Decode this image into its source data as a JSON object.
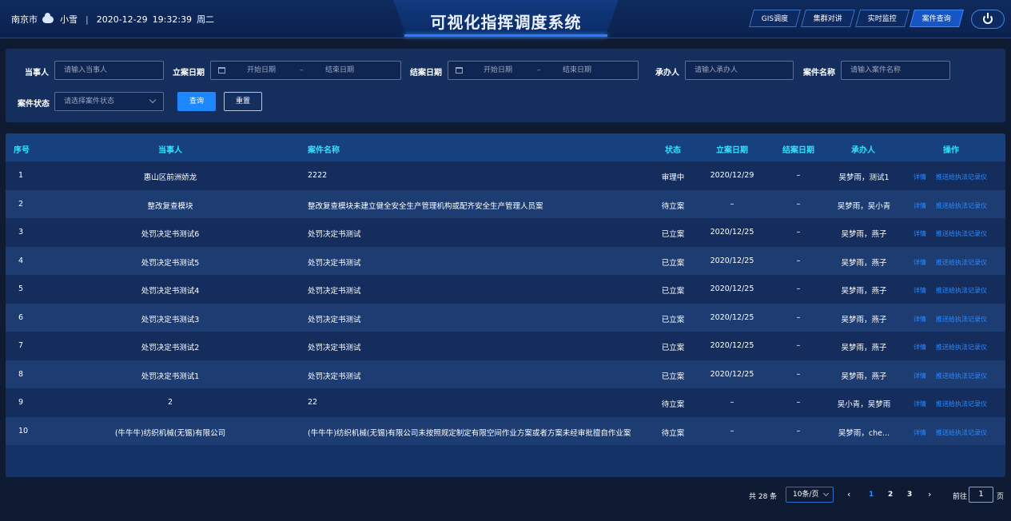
{
  "header": {
    "city": "南京市",
    "weather_icon": "cloud-icon",
    "weather": "小雪",
    "date": "2020-12-29",
    "time": "19:32:39",
    "weekday": "周二",
    "title": "可视化指挥调度系统",
    "nav": [
      "GIS调度",
      "集群对讲",
      "实时监控",
      "案件查询"
    ],
    "active_nav": "案件查询",
    "power_icon": "power-icon"
  },
  "filter": {
    "party_label": "当事人",
    "party_placeholder": "请输入当事人",
    "filing_date_label": "立案日期",
    "closing_date_label": "结案日期",
    "start_placeholder": "开始日期",
    "end_placeholder": "结束日期",
    "range_sep": "–",
    "handler_label": "承办人",
    "handler_placeholder": "请输入承办人",
    "case_name_label": "案件名称",
    "case_name_placeholder": "请输入案件名称",
    "status_label": "案件状态",
    "status_placeholder": "请选择案件状态",
    "query_button": "查询",
    "reset_button": "重置"
  },
  "table": {
    "headers": {
      "seq": "序号",
      "party": "当事人",
      "case_name": "案件名称",
      "status": "状态",
      "filing_date": "立案日期",
      "closing_date": "结案日期",
      "handler": "承办人",
      "actions": "操作"
    },
    "rows": [
      {
        "seq": "1",
        "party": "惠山区前洲娇龙",
        "case_name": "2222",
        "status": "审理中",
        "filing_date": "2020/12/29",
        "closing_date": "–",
        "handler": "吴梦雨，测试1",
        "detail": "详情",
        "push": "推送给执法记录仪"
      },
      {
        "seq": "2",
        "party": "整改复查模块",
        "case_name": "整改复查模块未建立健全安全生产管理机构或配齐安全生产管理人员案",
        "status": "待立案",
        "filing_date": "–",
        "closing_date": "–",
        "handler": "吴梦雨，吴小青",
        "detail": "详情",
        "push": "推送给执法记录仪"
      },
      {
        "seq": "3",
        "party": "处罚决定书测试6",
        "case_name": "处罚决定书测试",
        "status": "已立案",
        "filing_date": "2020/12/25",
        "closing_date": "–",
        "handler": "吴梦雨，燕子",
        "detail": "详情",
        "push": "推送给执法记录仪"
      },
      {
        "seq": "4",
        "party": "处罚决定书测试5",
        "case_name": "处罚决定书测试",
        "status": "已立案",
        "filing_date": "2020/12/25",
        "closing_date": "–",
        "handler": "吴梦雨，燕子",
        "detail": "详情",
        "push": "推送给执法记录仪"
      },
      {
        "seq": "5",
        "party": "处罚决定书测试4",
        "case_name": "处罚决定书测试",
        "status": "已立案",
        "filing_date": "2020/12/25",
        "closing_date": "–",
        "handler": "吴梦雨，燕子",
        "detail": "详情",
        "push": "推送给执法记录仪"
      },
      {
        "seq": "6",
        "party": "处罚决定书测试3",
        "case_name": "处罚决定书测试",
        "status": "已立案",
        "filing_date": "2020/12/25",
        "closing_date": "–",
        "handler": "吴梦雨，燕子",
        "detail": "详情",
        "push": "推送给执法记录仪"
      },
      {
        "seq": "7",
        "party": "处罚决定书测试2",
        "case_name": "处罚决定书测试",
        "status": "已立案",
        "filing_date": "2020/12/25",
        "closing_date": "–",
        "handler": "吴梦雨，燕子",
        "detail": "详情",
        "push": "推送给执法记录仪"
      },
      {
        "seq": "8",
        "party": "处罚决定书测试1",
        "case_name": "处罚决定书测试",
        "status": "已立案",
        "filing_date": "2020/12/25",
        "closing_date": "–",
        "handler": "吴梦雨，燕子",
        "detail": "详情",
        "push": "推送给执法记录仪"
      },
      {
        "seq": "9",
        "party": "2",
        "case_name": "22",
        "status": "待立案",
        "filing_date": "–",
        "closing_date": "–",
        "handler": "吴小青，吴梦雨",
        "detail": "详情",
        "push": "推送给执法记录仪"
      },
      {
        "seq": "10",
        "party": "(牛牛牛)纺织机械(无锡)有限公司",
        "case_name": "(牛牛牛)纺织机械(无锡)有限公司未按照规定制定有限空间作业方案或者方案未经审批擅自作业案",
        "status": "待立案",
        "filing_date": "–",
        "closing_date": "–",
        "handler": "吴梦雨，che...",
        "detail": "详情",
        "push": "推送给执法记录仪"
      }
    ]
  },
  "pagination": {
    "total": "共 28 条",
    "page_size": "10条/页",
    "prev_icon": "chevron-left-icon",
    "next_icon": "chevron-right-icon",
    "pages": [
      "1",
      "2",
      "3"
    ],
    "current_page": "1",
    "goto_label": "前往",
    "goto_value": "1",
    "page_unit": "页"
  },
  "colors": {
    "background": "#0f1a33",
    "header_cyan": "#30e2ff",
    "link_blue": "#2e8bff",
    "primary_button": "#1d87ff"
  }
}
